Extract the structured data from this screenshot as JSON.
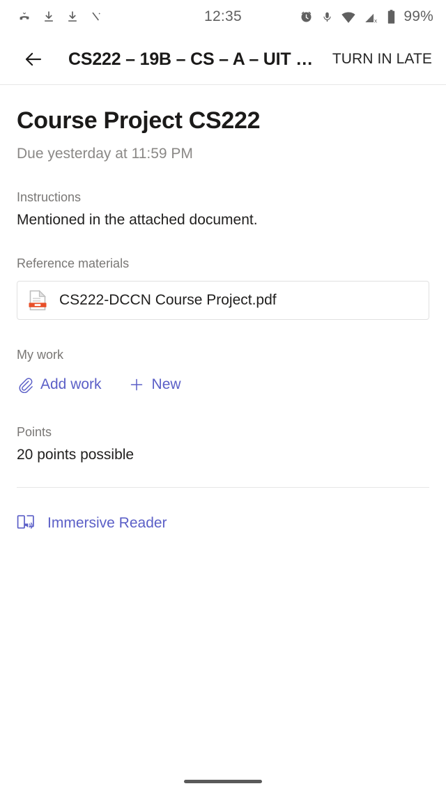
{
  "status_bar": {
    "time": "12:35",
    "battery_percent": "99%",
    "left_icons": [
      "missed-call-icon",
      "download-icon",
      "download-icon",
      "call-slash-icon"
    ],
    "right_icons": [
      "alarm-icon",
      "microphone-icon",
      "wifi-icon",
      "cellular-no-sim-icon",
      "battery-icon"
    ]
  },
  "app_bar": {
    "back_icon": "back-arrow-icon",
    "title": "CS222 – 19B – CS – A – UIT …",
    "action_label": "TURN IN LATE"
  },
  "assignment": {
    "title": "Course Project CS222",
    "due": "Due yesterday at 11:59 PM",
    "instructions_label": "Instructions",
    "instructions_text": "Mentioned in the attached document.",
    "reference_label": "Reference materials",
    "reference_file": {
      "name": "CS222-DCCN Course Project.pdf",
      "icon": "pdf-file-icon"
    },
    "my_work_label": "My work",
    "add_work_label": "Add work",
    "new_label": "New",
    "points_label": "Points",
    "points_value": "20 points possible"
  },
  "footer": {
    "immersive_reader_label": "Immersive Reader",
    "immersive_reader_icon": "immersive-reader-icon"
  },
  "colors": {
    "brand_purple": "#5b5fc7",
    "text_primary": "#201f1e",
    "text_secondary": "#797775",
    "due_text": "#8a8886",
    "pdf_accent": "#e8502a",
    "divider": "#e6e6e6"
  }
}
